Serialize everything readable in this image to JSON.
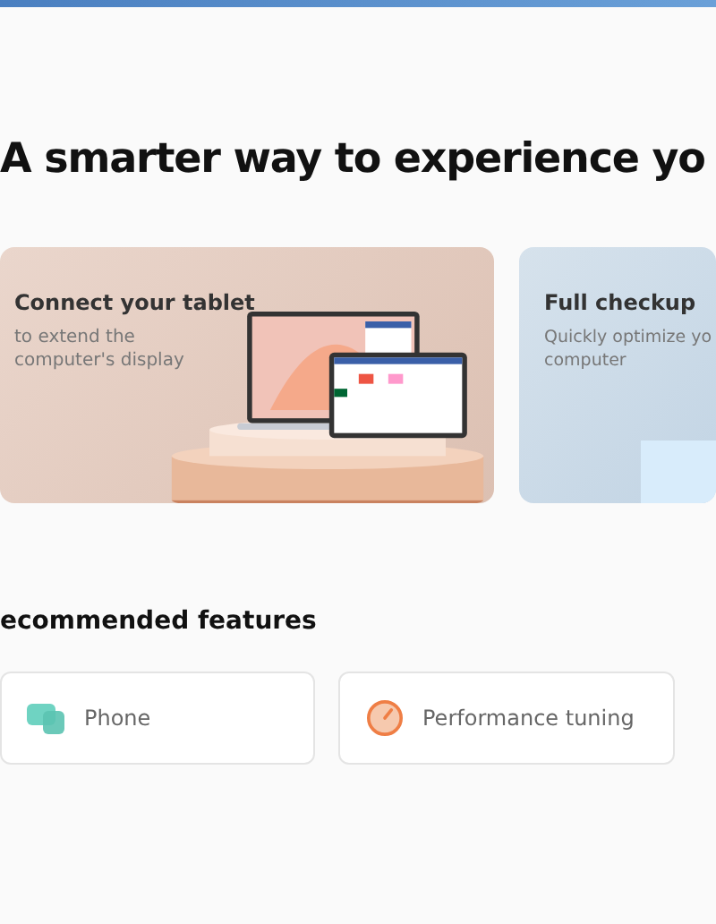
{
  "heading": "A smarter way to experience yo",
  "cards": [
    {
      "kind": "tablet",
      "title": "Connect your tablet",
      "lines": [
        "to extend the",
        "computer's display"
      ]
    },
    {
      "kind": "checkup",
      "title": "Full checkup",
      "lines": [
        "Quickly optimize yo",
        "computer"
      ]
    }
  ],
  "section_title": "ecommended features",
  "features": [
    {
      "kind": "phone",
      "label": "Phone"
    },
    {
      "kind": "performance",
      "label": "Performance tuning"
    }
  ]
}
